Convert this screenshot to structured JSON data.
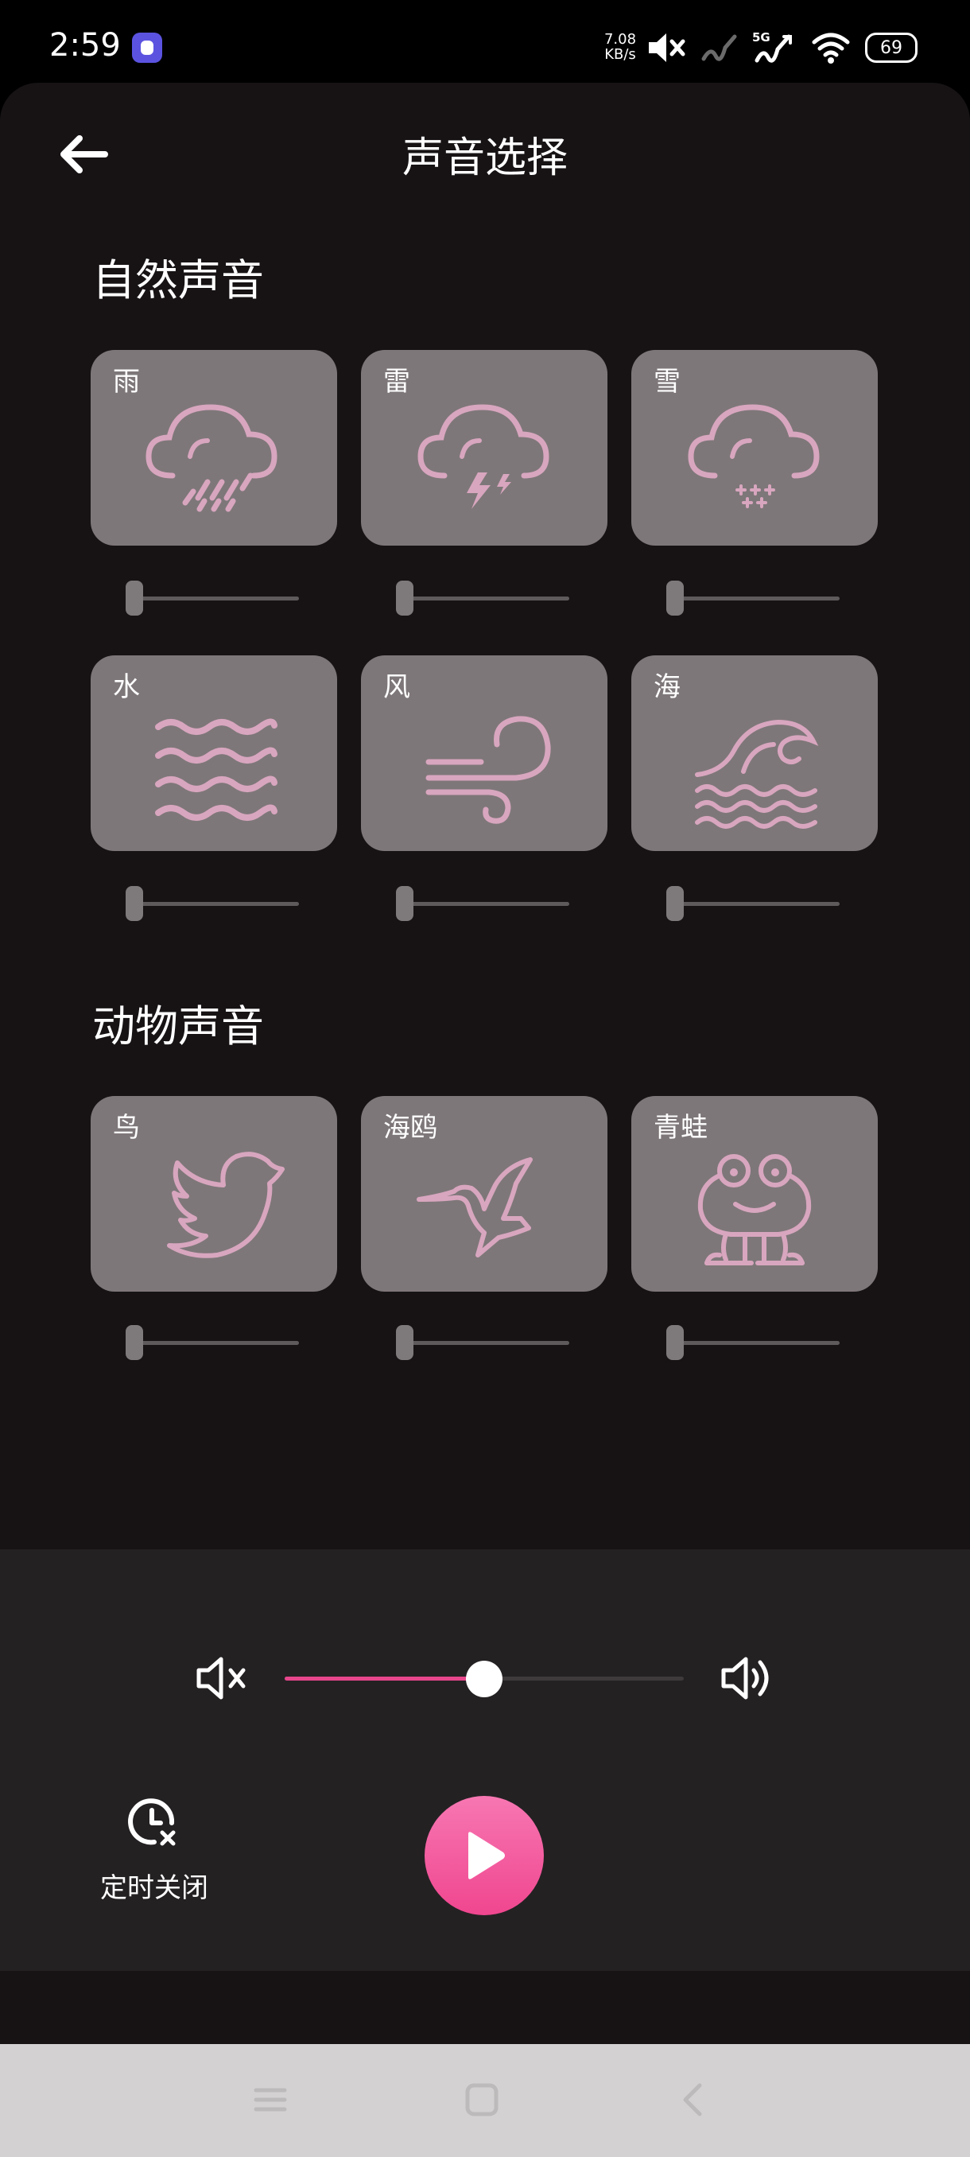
{
  "status": {
    "time": "2:59",
    "net_speed_value": "7.08",
    "net_speed_unit": "KB/s",
    "network_label": "5G",
    "battery": "69"
  },
  "header": {
    "title": "声音选择"
  },
  "sections": {
    "nature": {
      "title": "自然声音",
      "items": [
        {
          "label": "雨",
          "icon": "rain-cloud-icon",
          "volume": 0
        },
        {
          "label": "雷",
          "icon": "thunder-cloud-icon",
          "volume": 0
        },
        {
          "label": "雪",
          "icon": "snow-cloud-icon",
          "volume": 0
        },
        {
          "label": "水",
          "icon": "water-waves-icon",
          "volume": 0
        },
        {
          "label": "风",
          "icon": "wind-icon",
          "volume": 0
        },
        {
          "label": "海",
          "icon": "ocean-wave-icon",
          "volume": 0
        }
      ]
    },
    "animals": {
      "title": "动物声音",
      "items": [
        {
          "label": "鸟",
          "icon": "bird-icon",
          "volume": 0
        },
        {
          "label": "海鸥",
          "icon": "seagull-icon",
          "volume": 0
        },
        {
          "label": "青蛙",
          "icon": "frog-icon",
          "volume": 0
        }
      ]
    }
  },
  "player": {
    "master_volume": 0.5,
    "timer_label": "定时关闭"
  },
  "colors": {
    "accent": "#e8468c",
    "tile_bg": "#7e7779",
    "icon_color": "#d8a6bf",
    "panel_bg": "#171314",
    "player_bg": "#242123"
  }
}
